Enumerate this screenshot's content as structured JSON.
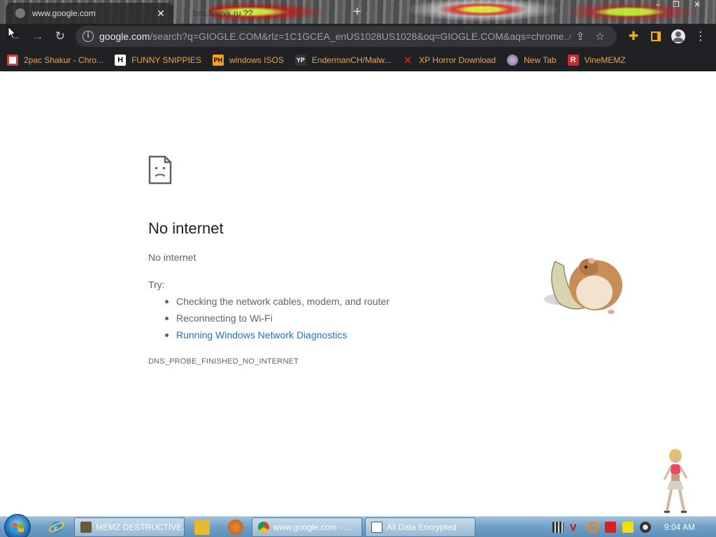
{
  "browser": {
    "tabs": [
      {
        "title": "www.google.com",
        "active": true
      },
      {
        "title": "box.hamik.ru ??",
        "active": false
      }
    ],
    "new_tab_symbol": "+",
    "window_controls": {
      "minimize": "–",
      "restore": "❐",
      "close": "✕"
    },
    "address_bar": {
      "host": "google.com",
      "path": "/search?q=GIOGLE.COM&rlz=1C1GCEA_enUS1028US1028&oq=GIOGLE.COM&aqs=chrome..69..."
    },
    "bookmarks": [
      {
        "label": "2pac Shakur - Chro...",
        "icon": "red-box-icon",
        "icon_color": "#d23b3b"
      },
      {
        "label": "FUNNY SNIPPIES",
        "icon": "h-letter-icon",
        "icon_color": "#ffffff"
      },
      {
        "label": "windows ISOS",
        "icon": "ph-icon",
        "icon_color": "#f7a21b"
      },
      {
        "label": "EndermanCH/Malw...",
        "icon": "yp-icon",
        "icon_color": "#333333"
      },
      {
        "label": "XP Horror Download",
        "icon": "red-x-icon",
        "icon_color": "#e0221c"
      },
      {
        "label": "New Tab",
        "icon": "globe-icon",
        "icon_color": "#9a8fa8"
      },
      {
        "label": "VineMEMZ",
        "icon": "r-letter-icon",
        "icon_color": "#d12a2a"
      }
    ]
  },
  "error_page": {
    "title": "No internet",
    "message": "No internet",
    "try_label": "Try:",
    "suggestions": [
      "Checking the network cables, modem, and router",
      "Reconnecting to Wi-Fi"
    ],
    "diagnostics_link": "Running Windows Network Diagnostics",
    "error_code": "DNS_PROBE_FINISHED_NO_INTERNET"
  },
  "taskbar": {
    "tasks": [
      {
        "label": "MEMZ DESTRUCTIVE..."
      },
      {
        "label": "www.google.com - ..."
      },
      {
        "label": "All Data Encrypted"
      }
    ],
    "clock": "9:04 AM"
  },
  "colors": {
    "link": "#1a73e8",
    "bookmark_text": "#f0a040",
    "toolbar_bg": "#202124"
  }
}
